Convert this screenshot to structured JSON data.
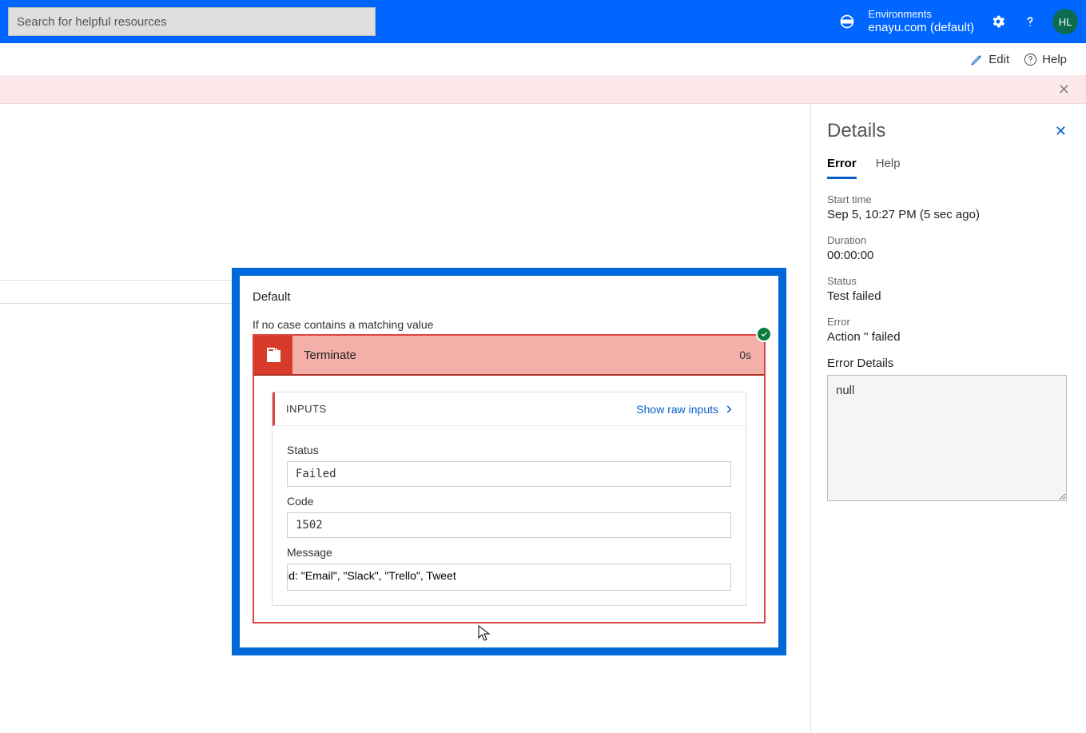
{
  "header": {
    "search_placeholder": "Search for helpful resources",
    "environments_label": "Environments",
    "environment_value": "enayu.com (default)",
    "avatar_initials": "HL"
  },
  "commands": {
    "edit": "Edit",
    "help": "Help"
  },
  "flow": {
    "default_label": "Default",
    "caption": "If no case contains a matching value",
    "terminate_label": "Terminate",
    "terminate_duration": "0s",
    "inputs_title": "INPUTS",
    "show_raw": "Show raw inputs",
    "status_label": "Status",
    "status_value": "Failed",
    "code_label": "Code",
    "code_value": "1502",
    "message_label": "Message",
    "message_value": "of the following values stupid: \"Email\", \"Slack\", \"Trello\", Tweet"
  },
  "details": {
    "title": "Details",
    "tabs": {
      "error": "Error",
      "help": "Help"
    },
    "start_time_label": "Start time",
    "start_time_value": "Sep 5, 10:27 PM (5 sec ago)",
    "duration_label": "Duration",
    "duration_value": "00:00:00",
    "status_label": "Status",
    "status_value": "Test failed",
    "error_label": "Error",
    "error_value": "Action '' failed",
    "error_details_label": "Error Details",
    "error_details_value": "null"
  }
}
